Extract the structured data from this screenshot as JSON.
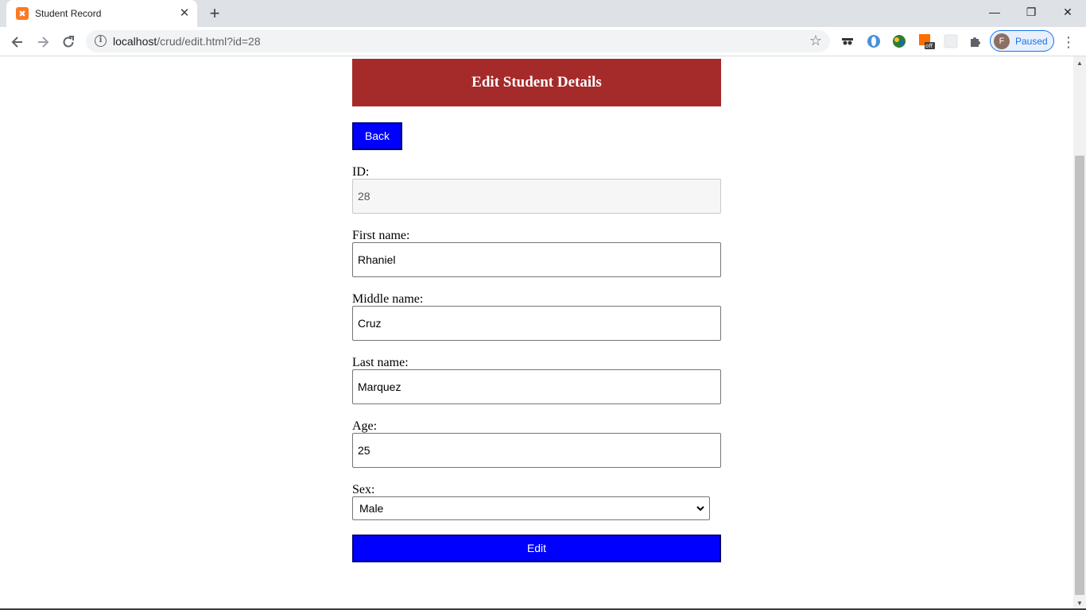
{
  "browser": {
    "tab_title": "Student Record",
    "tab_close": "✕",
    "new_tab": "+",
    "favicon_letter": "✖",
    "url_host": "localhost",
    "url_path": "/crud/edit.html?id=28",
    "profile_initial": "F",
    "profile_status": "Paused",
    "window": {
      "minimize": "—",
      "restore": "❐",
      "close": "✕"
    }
  },
  "page": {
    "heading": "Edit Student Details",
    "back_label": "Back",
    "fields": {
      "id": {
        "label": "ID:",
        "value": "28"
      },
      "first_name": {
        "label": "First name:",
        "value": "Rhaniel"
      },
      "middle_name": {
        "label": "Middle name:",
        "value": "Cruz"
      },
      "last_name": {
        "label": "Last name:",
        "value": "Marquez"
      },
      "age": {
        "label": "Age:",
        "value": "25"
      },
      "sex": {
        "label": "Sex:",
        "value": "Male"
      }
    },
    "submit_label": "Edit"
  },
  "colors": {
    "banner": "#a52a2a",
    "button": "#0000ff",
    "accent": "#1a73e8"
  },
  "icons": [
    "xampp-favicon-icon",
    "info-icon",
    "star-icon",
    "extension-icons",
    "puzzle-icon",
    "kebab-menu-icon",
    "chevron-down-icon"
  ]
}
